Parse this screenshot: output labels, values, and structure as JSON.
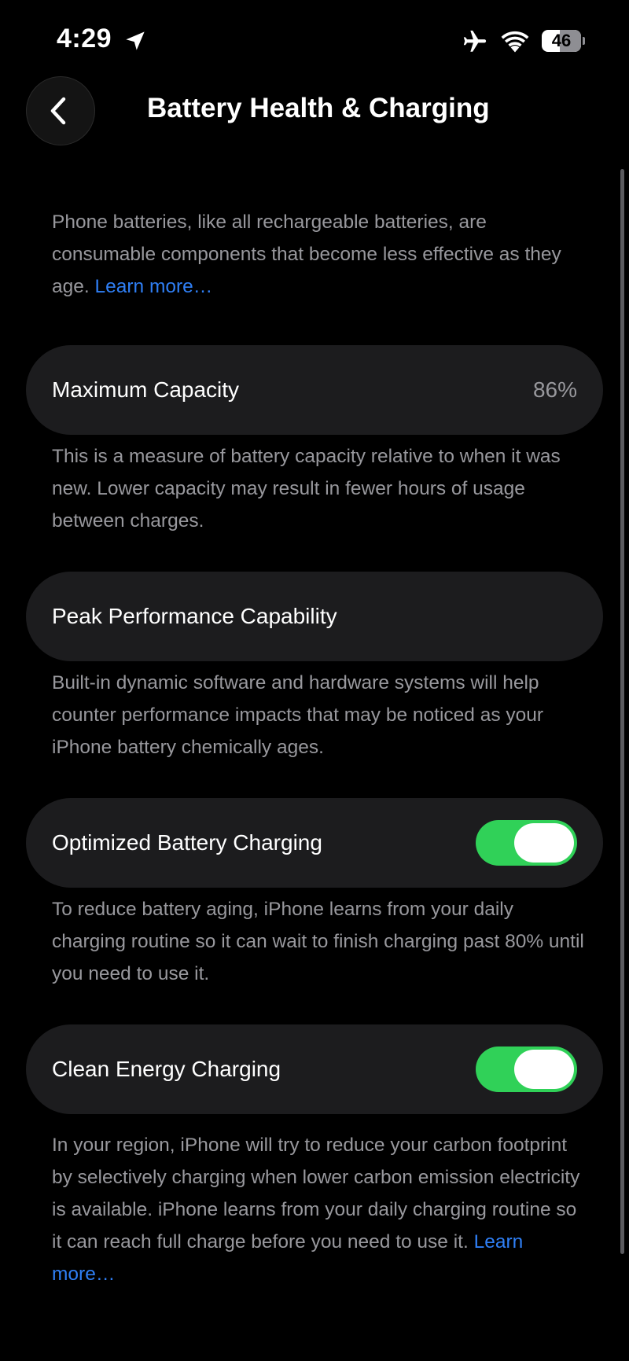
{
  "status_bar": {
    "time": "4:29",
    "battery_level": "46",
    "battery_fraction": 0.46,
    "icons": [
      "location-arrow-icon",
      "airplane-icon",
      "wifi-icon",
      "battery-icon"
    ]
  },
  "header": {
    "back_icon": "chevron-left-icon",
    "title": "Battery Health & Charging"
  },
  "intro": {
    "text": "Phone batteries, like all rechargeable batteries, are consumable components that become less effective as they age.",
    "link": "Learn more…"
  },
  "max_capacity": {
    "label": "Maximum Capacity",
    "value": "86%",
    "description": "This is a measure of battery capacity relative to when it was new. Lower capacity may result in fewer hours of usage between charges."
  },
  "peak_performance": {
    "label": "Peak Performance Capability",
    "description": "Built-in dynamic software and hardware systems will help counter performance impacts that may be noticed as your iPhone battery chemically ages."
  },
  "optimized_charging": {
    "label": "Optimized Battery Charging",
    "enabled": true,
    "description": "To reduce battery aging, iPhone learns from your daily charging routine so it can wait to finish charging past 80% until you need to use it."
  },
  "clean_energy": {
    "label": "Clean Energy Charging",
    "enabled": true,
    "description": "In your region, iPhone will try to reduce your carbon footprint by selectively charging when lower carbon emission electricity is available. iPhone learns from your daily charging routine so it can reach full charge before you need to use it.",
    "link": "Learn more…"
  },
  "colors": {
    "background": "#000000",
    "card": "#1c1c1e",
    "secondary_text": "#98989d",
    "link": "#2f7ff5",
    "toggle_on": "#30d158"
  }
}
